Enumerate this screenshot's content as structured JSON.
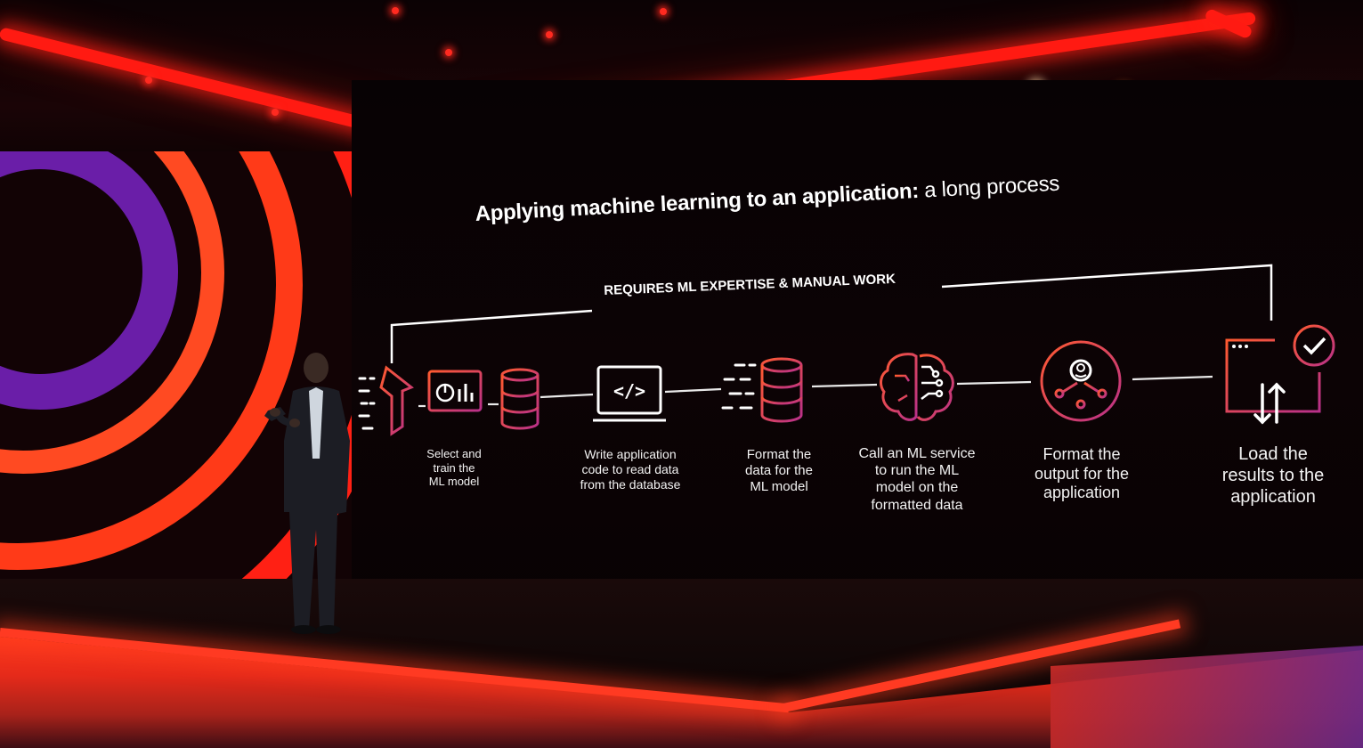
{
  "slide": {
    "title_bold": "Applying machine learning to an application:",
    "title_light": " a long process",
    "bracket_label": "REQUIRES ML EXPERTISE & MANUAL WORK"
  },
  "steps": [
    {
      "icon": "ml-model-training-icon",
      "label": "Select and\ntrain the\nML model"
    },
    {
      "icon": "code-laptop-icon",
      "label": "Write application\ncode to read data\nfrom the database"
    },
    {
      "icon": "database-format-icon",
      "label": "Format the\ndata for the\nML model"
    },
    {
      "icon": "brain-circuit-icon",
      "label": "Call an ML service\nto run the ML\nmodel on the\nformatted data"
    },
    {
      "icon": "user-hub-icon",
      "label": "Format the\noutput for the\napplication"
    },
    {
      "icon": "app-window-check-icon",
      "label": "Load the\nresults to the\napplication"
    }
  ],
  "colors": {
    "accent_red": "#ff2a1c",
    "icon_gradient_start": "#ff4a2a",
    "icon_gradient_end": "#c03a8a",
    "text": "#ffffff"
  }
}
